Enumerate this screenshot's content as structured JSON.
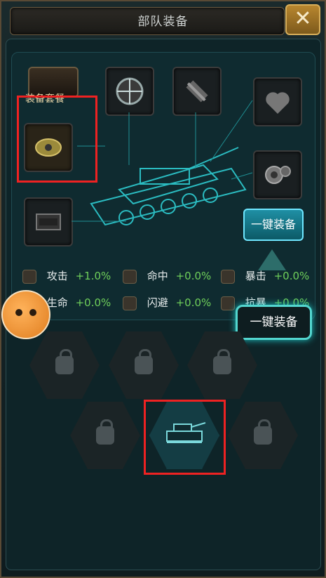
{
  "header": {
    "title": "部队装备",
    "close_icon": "close-x"
  },
  "slots": {
    "suite_label": "装备套餐",
    "items": [
      {
        "name": "sight-icon"
      },
      {
        "name": "barrel-icon"
      },
      {
        "name": "shell-icon"
      },
      {
        "name": "armor-box-icon"
      },
      {
        "name": "heart-icon"
      },
      {
        "name": "gear-icon"
      }
    ]
  },
  "buttons": {
    "one_key_equip": "一键装备"
  },
  "tooltip": {
    "text": "一键装备"
  },
  "stats": [
    {
      "label": "攻击",
      "value": "+1.0%",
      "icon": "attack-icon"
    },
    {
      "label": "命中",
      "value": "+0.0%",
      "icon": "accuracy-icon"
    },
    {
      "label": "暴击",
      "value": "+0.0%",
      "icon": "crit-icon"
    },
    {
      "label": "生命",
      "value": "+0.0%",
      "icon": "health-icon"
    },
    {
      "label": "闪避",
      "value": "+0.0%",
      "icon": "dodge-icon"
    },
    {
      "label": "抗暴",
      "value": "+0.0%",
      "icon": "anti-crit-icon"
    }
  ],
  "accent_colors": {
    "primary": "#53d6cf",
    "green": "#6fcf5a",
    "gold": "#d8ae5a",
    "red": "#e22"
  }
}
